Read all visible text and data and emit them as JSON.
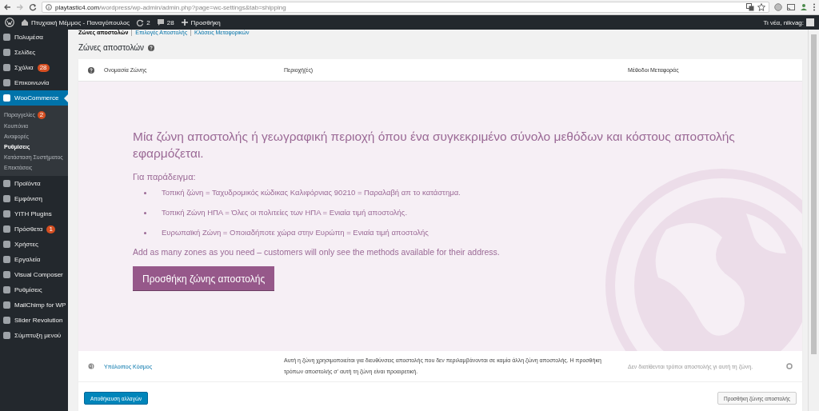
{
  "browser": {
    "url_host": "playtastic4.com",
    "url_path": "/wordpress/wp-admin/admin.php?page=wc-settings&tab=shipping"
  },
  "admin_bar": {
    "site_name": "Πτυχιακή Μέμμος - Παναγόπουλος",
    "updates": "2",
    "comments": "28",
    "new_label": "Προσθήκη",
    "greeting": "Τι νέα, nikvag:"
  },
  "sidebar": {
    "items": [
      {
        "label": "Πολυμέσα",
        "selected": false
      },
      {
        "label": "Σελίδες",
        "selected": false
      },
      {
        "label": "Σχόλια",
        "selected": false,
        "badge": "28"
      },
      {
        "label": "Επικοινωνία",
        "selected": false
      },
      {
        "label": "WooCommerce",
        "selected": true,
        "children": [
          {
            "label": "Παραγγελίες",
            "selected": false,
            "badge": "2"
          },
          {
            "label": "Κουπόνια",
            "selected": false
          },
          {
            "label": "Αναφορές",
            "selected": false
          },
          {
            "label": "Ρυθμίσεις",
            "selected": true
          },
          {
            "label": "Κατάσταση Συστήματος",
            "selected": false
          },
          {
            "label": "Επεκτάσεις",
            "selected": false
          }
        ]
      },
      {
        "label": "Προϊόντα",
        "selected": false
      },
      {
        "label": "Εμφάνιση",
        "selected": false
      },
      {
        "label": "YITH Plugins",
        "selected": false
      },
      {
        "label": "Πρόσθετα",
        "selected": false,
        "badge": "1"
      },
      {
        "label": "Χρήστες",
        "selected": false
      },
      {
        "label": "Εργαλεία",
        "selected": false
      },
      {
        "label": "Visual Composer",
        "selected": false
      },
      {
        "label": "Ρυθμίσεις",
        "selected": false
      },
      {
        "label": "MailChimp for WP",
        "selected": false
      },
      {
        "label": "Slider Revolution",
        "selected": false
      },
      {
        "label": "Σύμπτυξη μενού",
        "selected": false
      }
    ]
  },
  "subnav": [
    {
      "label": "Ζώνες αποστολών",
      "selected": true
    },
    {
      "label": "Επιλογές Αποστολής",
      "selected": false
    },
    {
      "label": "Κλάσεις Μεταφορικών",
      "selected": false
    }
  ],
  "heading": "Ζώνες αποστολών",
  "table": {
    "columns": [
      "Ονομασία Ζώνης",
      "Περιοχή(ές)",
      "Μέθοδοι Μεταφοράς"
    ],
    "blank_state": {
      "lead": "Μία ζώνη αποστολής ή γεωγραφική περιοχή όπου ένα συγκεκριμένο σύνολο μεθόδων και κόστους αποστολής εφαρμόζεται.",
      "example_label": "Για παράδειγμα:",
      "examples": [
        "Τοπική ζώνη = Ταχυδρομικός κώδικας Καλιφόρνιας 90210 = Παραλαβή απ το κατάστημα.",
        "Τοπική Ζώνη ΗΠΑ = Όλες οι πολιτείες των ΗΠΑ = Ενιαία τιμή αποστολής.",
        "Ευρωπαϊκή Ζώνη = Οποιαδήποτε χώρα στην Ευρώπη = Ενιαία τιμή αποστολής"
      ],
      "note": "Add as many zones as you need – customers will only see the methods available for their address.",
      "button": "Προσθήκη ζώνης αποστολής"
    },
    "rows": [
      {
        "name": "Υπόλοιπος Κόσμος",
        "region": "Αυτή η ζώνη χρησιμοποιείται για διευθύνσεις αποστολής που δεν περιλαμβάνονται σε καμία άλλη ζώνη αποστολής. Η προσθήκη τρόπων αποστολής σ' αυτή τη ζώνη είναι προαιρετική.",
        "methods": "Δεν διατίθενται τρόποι αποστολής γι αυτή τη ζώνη."
      }
    ]
  },
  "save_button": "Αποθήκευση αλλαγών",
  "add_zone_button": "Προσθήκη ζώνης αποστολής"
}
